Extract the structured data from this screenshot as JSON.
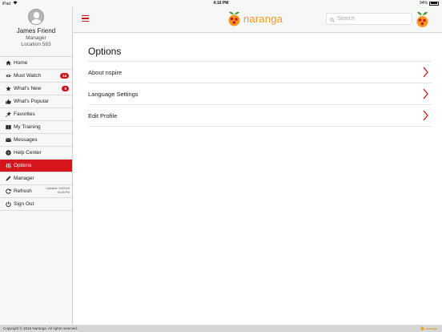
{
  "status_bar": {
    "carrier": "iPad",
    "wifi_icon": "wifi-icon",
    "time": "4:16 PM",
    "battery": "94%",
    "battery_level": 0.94
  },
  "profile": {
    "name": "James Friend",
    "role": "Manager",
    "location": "Location 583"
  },
  "menu": {
    "items": [
      {
        "label": "Home",
        "icon": "home-icon"
      },
      {
        "label": "Must Watch",
        "icon": "eye-icon",
        "badge": "14"
      },
      {
        "label": "What's New",
        "icon": "star-icon",
        "badge": "9"
      },
      {
        "label": "What's Popular",
        "icon": "thumbs-up-icon"
      },
      {
        "label": "Favorites",
        "icon": "pin-icon"
      },
      {
        "label": "My Training",
        "icon": "book-icon"
      },
      {
        "label": "Messages",
        "icon": "envelope-icon"
      },
      {
        "label": "Help Center",
        "icon": "question-icon"
      },
      {
        "label": "Options",
        "icon": "sliders-icon",
        "active": true
      },
      {
        "label": "Manager",
        "icon": "pencil-icon"
      },
      {
        "label": "Refresh",
        "icon": "refresh-icon",
        "meta_line1": "Updated: 1/4/2016",
        "meta_line2": "04:39 PM"
      },
      {
        "label": "Sign Out",
        "icon": "power-icon"
      }
    ]
  },
  "header": {
    "menu_icon": "hamburger-icon",
    "brand": "naranga",
    "search_placeholder": "Search",
    "search_value": ""
  },
  "main": {
    "title": "Options",
    "options": [
      {
        "label": "About nspire"
      },
      {
        "label": "Language Settings"
      },
      {
        "label": "Edit Profile"
      }
    ]
  },
  "footer": {
    "copyright": "Copyright © 2016 Naranga. All rights reserved.",
    "brand": "naranga"
  },
  "colors": {
    "accent": "#d7151d",
    "brand_orange": "#f39a1e",
    "leaf_green": "#3a9b2e"
  }
}
